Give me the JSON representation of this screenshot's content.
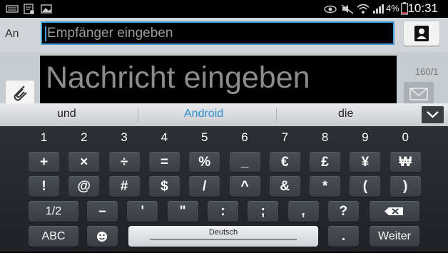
{
  "status_bar": {
    "battery_percent": "4%",
    "time": "10:31"
  },
  "compose": {
    "to_label": "An",
    "recipient_placeholder": "Empfänger eingeben",
    "message_placeholder": "Nachricht eingeben",
    "char_counter": "160/1"
  },
  "keyboard": {
    "suggestions": [
      "und",
      "Android",
      "die"
    ],
    "active_suggestion_index": 1,
    "number_row": [
      "1",
      "2",
      "3",
      "4",
      "5",
      "6",
      "7",
      "8",
      "9",
      "0"
    ],
    "row2": [
      "+",
      "×",
      "÷",
      "=",
      "%",
      "_",
      "€",
      "£",
      "¥",
      "₩"
    ],
    "row3": [
      "!",
      "@",
      "#",
      "$",
      "/",
      "^",
      "&",
      "*",
      "(",
      ")"
    ],
    "row4_page": "1/2",
    "row4": [
      "–",
      "'",
      "\"",
      ":",
      ";",
      ",",
      "?"
    ],
    "abc_label": "ABC",
    "space_label": "Deutsch",
    "punct_label": ".",
    "enter_label": "Weiter"
  },
  "colors": {
    "accent": "#3fa0d8",
    "suggestion_active": "#2b8fd0"
  }
}
